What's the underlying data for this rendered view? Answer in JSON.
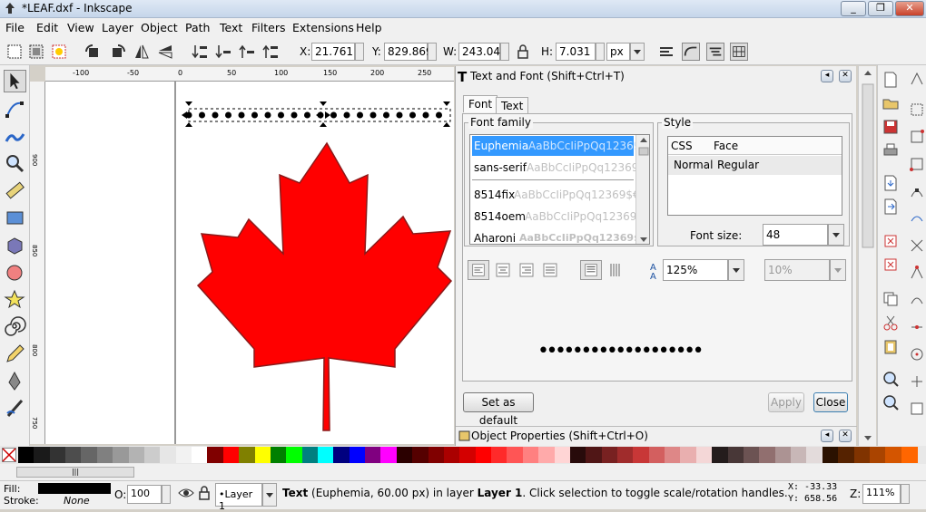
{
  "window": {
    "title": "*LEAF.dxf - Inkscape"
  },
  "menu": [
    "File",
    "Edit",
    "View",
    "Layer",
    "Object",
    "Path",
    "Text",
    "Filters",
    "Extensions",
    "Help"
  ],
  "toolbar": {
    "x_label": "X:",
    "x_value": "21.761",
    "y_label": "Y:",
    "y_value": "829.869",
    "w_label": "W:",
    "w_value": "243.047",
    "h_label": "H:",
    "h_value": "7.031",
    "unit": "px"
  },
  "ruler": {
    "h_ticks": [
      "-100",
      "-50",
      "0",
      "50",
      "100",
      "150",
      "200",
      "250"
    ],
    "v_ticks": [
      "900",
      "850",
      "800",
      "750"
    ]
  },
  "dialog": {
    "title": "Text and Font (Shift+Ctrl+T)",
    "tab_font": "Font",
    "tab_text": "Text",
    "font_family_label": "Font family",
    "style_label": "Style",
    "fonts": [
      {
        "name": "Euphemia",
        "preview": "AaBbCcIiPpQq12369"
      },
      {
        "name": "sans-serif",
        "preview": "AaBbCcIiPpQq12369$"
      },
      {
        "name": "8514fix",
        "preview": "AaBbCcIiPpQq12369$€"
      },
      {
        "name": "8514oem",
        "preview": "AaBbCcIiPpQq12369"
      },
      {
        "name": "Aharoni",
        "preview": "AaBbCcIiPpQq12369$"
      }
    ],
    "style_header_css": "CSS",
    "style_header_face": "Face",
    "style_row_css": "Normal",
    "style_row_face": "Regular",
    "font_size_label": "Font size:",
    "font_size_value": "48",
    "line_spacing": "125%",
    "letter_spacing": "10%",
    "preview_text": "•••••••••••••••••••",
    "set_default": "Set as default",
    "apply": "Apply",
    "close": "Close",
    "next_panel": "Object Properties (Shift+Ctrl+O)"
  },
  "palette_colors": [
    "#000000",
    "#1a1a1a",
    "#333333",
    "#4d4d4d",
    "#666666",
    "#808080",
    "#999999",
    "#b3b3b3",
    "#cccccc",
    "#e6e6e6",
    "#f2f2f2",
    "#ffffff",
    "#800000",
    "#ff0000",
    "#808000",
    "#ffff00",
    "#008000",
    "#00ff00",
    "#008080",
    "#00ffff",
    "#000080",
    "#0000ff",
    "#800080",
    "#ff00ff",
    "#2b0000",
    "#550000",
    "#800000",
    "#aa0000",
    "#d40000",
    "#ff0000",
    "#ff2a2a",
    "#ff5555",
    "#ff8080",
    "#ffaaaa",
    "#ffd5d5",
    "#280b0b",
    "#501616",
    "#782121",
    "#a02c2c",
    "#c83737",
    "#d35f5f",
    "#de8787",
    "#e9afaf",
    "#f4d7d7",
    "#241c1c",
    "#483737",
    "#6c5353",
    "#916f6f",
    "#ac9393",
    "#c8b7b7",
    "#e3dbdb",
    "#2b1100",
    "#552200",
    "#803300",
    "#aa4400",
    "#d45500",
    "#ff6600"
  ],
  "status": {
    "fill_label": "Fill:",
    "stroke_label": "Stroke:",
    "stroke_value": "None",
    "opacity_label": "O:",
    "opacity_value": "100",
    "layer": "•Layer 1",
    "message_bold": "Text",
    "message": "(Euphemia, 60.00 px) in layer",
    "message_layer": "Layer 1",
    "message_tail": ". Click selection to toggle scale/rotation handles.",
    "x_coord": "X: -33.33",
    "y_coord": "Y: 658.56",
    "zoom_label": "Z:",
    "zoom_value": "111%"
  }
}
